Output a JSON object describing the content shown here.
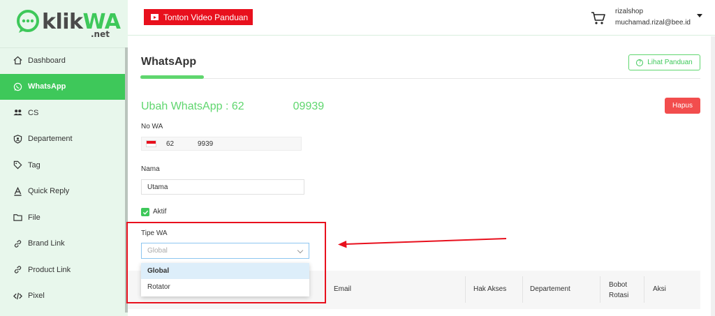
{
  "brand": {
    "logo_main": "klik",
    "logo_accent": "WA",
    "logo_suffix": ".net"
  },
  "colors": {
    "brand_green": "#3ec85a",
    "sidebar_bg": "#e8f7ec",
    "danger": "#f24d4d",
    "youtube_red": "#e8101d",
    "annotation_red": "#e8101d"
  },
  "sidebar": {
    "items": [
      {
        "label": "Dashboard",
        "icon": "home-icon"
      },
      {
        "label": "WhatsApp",
        "icon": "whatsapp-icon",
        "active": true
      },
      {
        "label": "CS",
        "icon": "users-icon"
      },
      {
        "label": "Departement",
        "icon": "shield-user-icon"
      },
      {
        "label": "Tag",
        "icon": "tag-icon"
      },
      {
        "label": "Quick Reply",
        "icon": "font-icon"
      },
      {
        "label": "File",
        "icon": "folder-icon"
      },
      {
        "label": "Brand Link",
        "icon": "link-icon"
      },
      {
        "label": "Product Link",
        "icon": "link-icon"
      },
      {
        "label": "Pixel",
        "icon": "code-icon"
      }
    ]
  },
  "topbar": {
    "video_button": "Tonton Video Panduan",
    "user_name": "rizalshop",
    "user_email": "muchamad.rizal@bee.id"
  },
  "page": {
    "title": "WhatsApp",
    "guide_button": "Lihat Panduan",
    "edit_title_prefix": "Ubah WhatsApp : 62",
    "edit_title_suffix": "09939",
    "delete_button": "Hapus"
  },
  "form": {
    "phone_label": "No WA",
    "phone_prefix": "62",
    "phone_suffix": "9939",
    "name_label": "Nama",
    "name_value": "Utama",
    "active_label": "Aktif",
    "active_checked": true,
    "type_label": "Tipe WA",
    "type_placeholder": "Global",
    "type_options": [
      "Global",
      "Rotator"
    ],
    "type_highlighted": "Global"
  },
  "table": {
    "headers": [
      "Email",
      "Hak Akses",
      "Departement",
      "Bobot",
      "Rotasi",
      "Aksi"
    ]
  }
}
